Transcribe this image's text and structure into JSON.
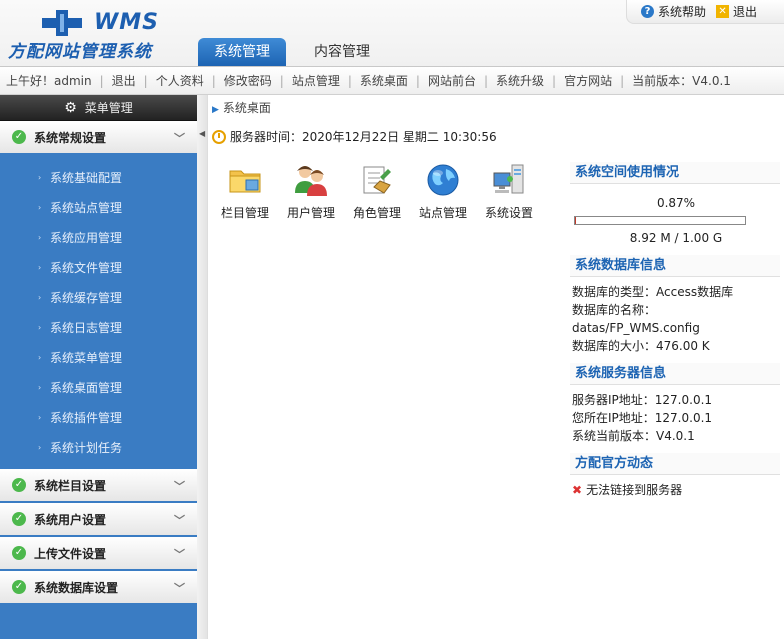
{
  "header": {
    "logo_text": "WMS",
    "subtitle": "方配网站管理系统",
    "help_label": "系统帮助",
    "exit_label": "退出",
    "tabs": [
      {
        "label": "系统管理",
        "active": true
      },
      {
        "label": "内容管理",
        "active": false
      }
    ]
  },
  "quick_nav": {
    "greeting": "上午好！admin",
    "items": [
      "退出",
      "个人资料",
      "修改密码",
      "站点管理",
      "系统桌面",
      "网站前台",
      "系统升级",
      "官方网站"
    ],
    "version_label": "当前版本：V4.0.1"
  },
  "sidebar": {
    "title": "菜单管理",
    "groups": [
      {
        "label": "系统常规设置",
        "items": [
          "系统基础配置",
          "系统站点管理",
          "系统应用管理",
          "系统文件管理",
          "系统缓存管理",
          "系统日志管理",
          "系统菜单管理",
          "系统桌面管理",
          "系统插件管理",
          "系统计划任务"
        ]
      },
      {
        "label": "系统栏目设置"
      },
      {
        "label": "系统用户设置"
      },
      {
        "label": "上传文件设置"
      },
      {
        "label": "系统数据库设置"
      }
    ]
  },
  "content": {
    "breadcrumb": "系统桌面",
    "server_time": "服务器时间：2020年12月22日  星期二  10:30:56",
    "quick_icons": [
      {
        "label": "栏目管理",
        "icon": "folder-icon"
      },
      {
        "label": "用户管理",
        "icon": "users-icon"
      },
      {
        "label": "角色管理",
        "icon": "role-icon"
      },
      {
        "label": "站点管理",
        "icon": "globe-icon"
      },
      {
        "label": "系统设置",
        "icon": "computer-icon"
      }
    ]
  },
  "right_panel": {
    "space": {
      "title": "系统空间使用情况",
      "percent_text": "0.87%",
      "percent_value": 0.87,
      "usage_text": "8.92 M / 1.00 G"
    },
    "database": {
      "title": "系统数据库信息",
      "lines": [
        "数据库的类型：Access数据库",
        "数据库的名称：",
        "datas/FP_WMS.config",
        "数据库的大小：476.00 K"
      ]
    },
    "server": {
      "title": "系统服务器信息",
      "lines": [
        "服务器IP地址：127.0.0.1",
        "您所在IP地址：127.0.0.1",
        "系统当前版本：V4.0.1"
      ]
    },
    "news": {
      "title": "方配官方动态",
      "message": "无法链接到服务器"
    }
  },
  "colors": {
    "accent": "#1d64b3",
    "sidebar_bg": "#3a7cc3",
    "check_green": "#4cb84c",
    "progress_fill": "#c0392b"
  }
}
